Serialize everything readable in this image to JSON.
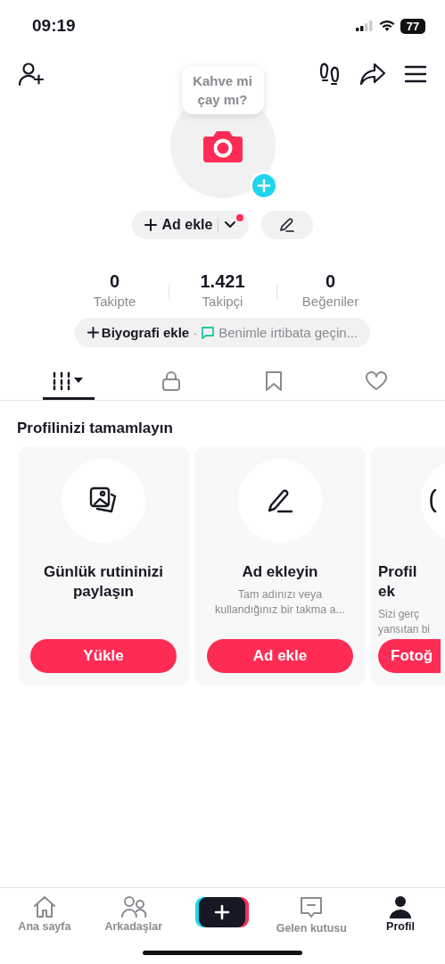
{
  "status_bar": {
    "time": "09:19",
    "battery": "77"
  },
  "avatar": {
    "bubble": "Kahve mi çay mı?"
  },
  "name_button": {
    "label": "Ad ekle",
    "has_notification": true
  },
  "stats": [
    {
      "value": "0",
      "label": "Takipte"
    },
    {
      "value": "1.421",
      "label": "Takipçi"
    },
    {
      "value": "0",
      "label": "Beğeniler"
    }
  ],
  "bio": {
    "add_label": "Biyografi ekle",
    "separator": "·",
    "contact": "Benimle irtibata geçin..."
  },
  "tabs": [
    {
      "kind": "videos",
      "selected": true
    },
    {
      "kind": "private",
      "selected": false
    },
    {
      "kind": "saved",
      "selected": false
    },
    {
      "kind": "liked",
      "selected": false
    }
  ],
  "section_title": "Profilinizi tamamlayın",
  "cards": [
    {
      "kind": "upload",
      "title": "Günlük rutininizi paylaşın",
      "button": "Yükle"
    },
    {
      "kind": "name",
      "title": "Ad ekleyin",
      "description": "Tam adınızı veya kullandığınız bir takma a...",
      "button": "Ad ekle"
    },
    {
      "kind": "photo",
      "title": "Profil ek",
      "description": "Sizi gerç yansıtan bi",
      "button": "Fotoğ"
    }
  ],
  "bottom_nav": [
    {
      "kind": "home",
      "label": "Ana sayfa",
      "selected": false
    },
    {
      "kind": "friends",
      "label": "Arkadaşlar",
      "selected": false
    },
    {
      "kind": "create",
      "selected": false
    },
    {
      "kind": "inbox",
      "label": "Gelen kutusu",
      "selected": false
    },
    {
      "kind": "profile",
      "label": "Profil",
      "selected": true
    }
  ]
}
